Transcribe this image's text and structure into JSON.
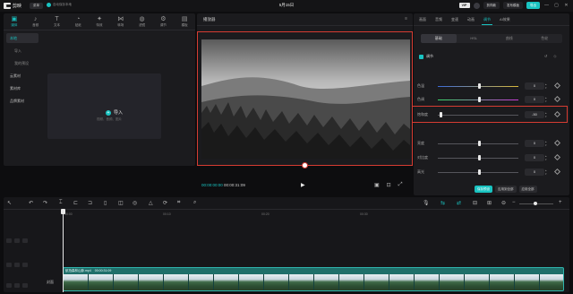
{
  "titlebar": {
    "app_name": "剪映",
    "menu_label": "菜单",
    "autosave": "自动保存本地",
    "doc_title": "5月15日",
    "vip": "VIP",
    "btn_template": "剪同款",
    "btn_publish": "发布模板",
    "btn_export": "导出",
    "win_min": "—",
    "win_max": "▢",
    "win_close": "✕"
  },
  "media": {
    "tabs": [
      {
        "label": "媒体",
        "icon": "▣"
      },
      {
        "label": "音频",
        "icon": "♪"
      },
      {
        "label": "文本",
        "icon": "T"
      },
      {
        "label": "贴纸",
        "icon": "◔"
      },
      {
        "label": "特效",
        "icon": "✦"
      },
      {
        "label": "转场",
        "icon": "⋈"
      },
      {
        "label": "滤镜",
        "icon": "◍"
      },
      {
        "label": "调节",
        "icon": "⚙"
      },
      {
        "label": "模板",
        "icon": "▤"
      }
    ],
    "side_nav": [
      "本地",
      "导入",
      "我的预设",
      "云素材",
      "素材库",
      "品牌素材"
    ],
    "import_label": "导入",
    "import_hint": "视频、音频、图片"
  },
  "player": {
    "title": "播放器",
    "menu_icon": "≡",
    "time_current": "00:00:00:00",
    "time_total": "00:00:31:09"
  },
  "inspector": {
    "tabs": [
      "画面",
      "音频",
      "变速",
      "动画",
      "调节",
      "AI效果"
    ],
    "active_tab": "调节",
    "segments": [
      "基础",
      "HSL",
      "曲线",
      "色轮"
    ],
    "section_title": "调节",
    "rows": [
      {
        "label": "色温",
        "value": "0"
      },
      {
        "label": "色调",
        "value": "0"
      },
      {
        "label": "饱和度",
        "value": "-50"
      },
      {
        "label": "亮度",
        "value": "0"
      },
      {
        "label": "对比度",
        "value": "0"
      },
      {
        "label": "高光",
        "value": "0"
      }
    ],
    "buttons": [
      "保存预设",
      "应用到全部",
      "应用全部"
    ]
  },
  "timeline": {
    "ruler": [
      "00:00",
      "00:10",
      "00:20",
      "00:30"
    ],
    "clip_name": "航拍森林山脉.mp4",
    "clip_duration": "00:00:31:09",
    "cover_label": "封面"
  },
  "colors": {
    "accent": "#19c3c1",
    "highlight": "#d63c32"
  }
}
